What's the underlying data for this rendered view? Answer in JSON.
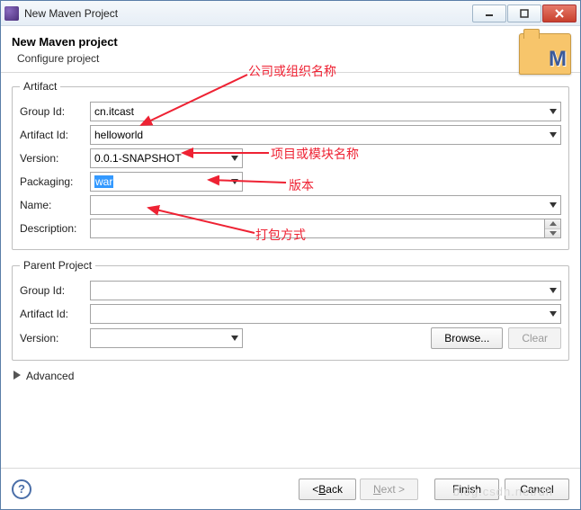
{
  "titlebar": {
    "title": "New Maven Project"
  },
  "banner": {
    "heading": "New Maven project",
    "sub": "Configure project",
    "logo_letter": "M"
  },
  "artifact": {
    "legend": "Artifact",
    "group_id_label": "Group Id:",
    "group_id": "cn.itcast",
    "artifact_id_label": "Artifact Id:",
    "artifact_id": "helloworld",
    "version_label": "Version:",
    "version": "0.0.1-SNAPSHOT",
    "packaging_label": "Packaging:",
    "packaging": "war",
    "name_label": "Name:",
    "name": "",
    "desc_label": "Description:",
    "desc": ""
  },
  "parent": {
    "legend": "Parent Project",
    "group_id_label": "Group Id:",
    "group_id": "",
    "artifact_id_label": "Artifact Id:",
    "artifact_id": "",
    "version_label": "Version:",
    "version": "",
    "browse": "Browse...",
    "clear": "Clear"
  },
  "advanced": {
    "label": "Advanced"
  },
  "footer": {
    "back": "Back",
    "next": "Next",
    "finish": "Finish",
    "cancel": "Cancel"
  },
  "annotations": {
    "a1": "公司或组织名称",
    "a2": "项目或模块名称",
    "a3": "版本",
    "a4": "打包方式"
  },
  "watermark": "blog.csdn.net/dh"
}
